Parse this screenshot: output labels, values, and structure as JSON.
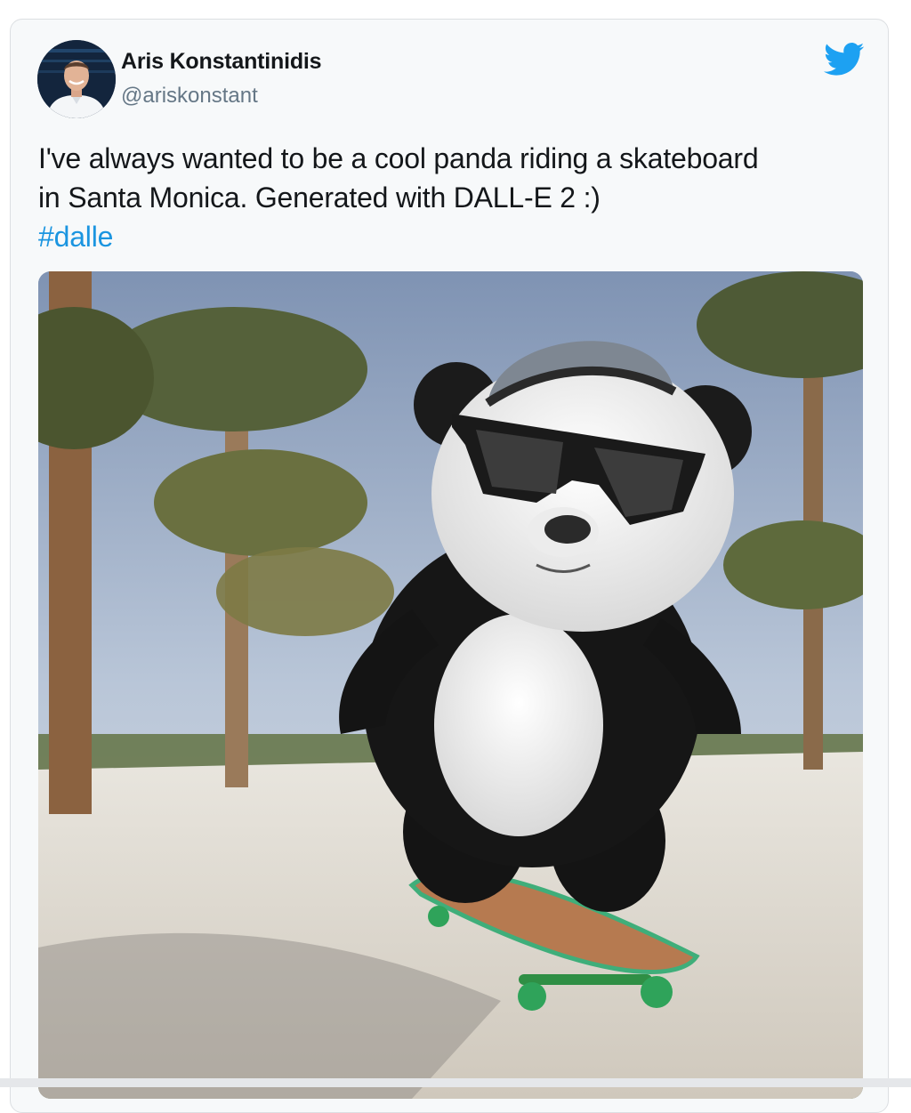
{
  "tweet": {
    "author": {
      "name": "Aris Konstantinidis",
      "handle": "@ariskonstant",
      "avatar_icon": "profile-photo"
    },
    "text_line_1": "I've always wanted to be a cool panda riding a skateboard",
    "text_line_2": "in Santa Monica. Generated with DALL-E 2 :)",
    "hashtag": "#dalle",
    "media": {
      "description_icon": "panda-skateboard-photo"
    }
  },
  "colors": {
    "twitter_blue": "#1da1f2",
    "hashtag_blue": "#1b95e0",
    "text": "#14171a",
    "muted": "#657786",
    "card_bg": "#f7f9fa"
  }
}
